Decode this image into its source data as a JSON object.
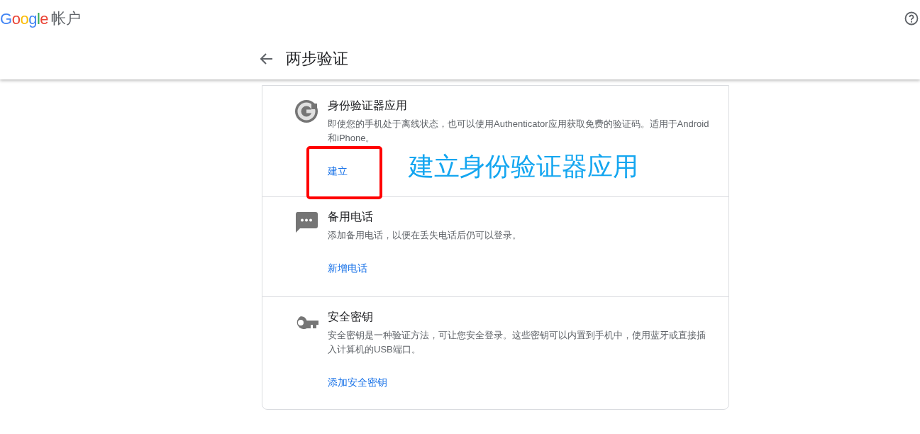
{
  "header": {
    "logo": "Google",
    "product": "帐户",
    "page_title": "两步验证"
  },
  "methods": [
    {
      "kind": "authenticator",
      "title": "身份验证器应用",
      "description": "即使您的手机处于离线状态，也可以使用Authenticator应用获取免费的验证码。适用于Android和iPhone。",
      "action": "建立"
    },
    {
      "kind": "phone",
      "title": "备用电话",
      "description": "添加备用电话，以便在丢失电话后仍可以登录。",
      "action": "新增电话"
    },
    {
      "kind": "key",
      "title": "安全密钥",
      "description": "安全密钥是一种验证方法，可让您安全登录。这些密钥可以内置到手机中，使用蓝牙或直接插入计算机的USB端口。",
      "action": "添加安全密钥"
    }
  ],
  "annotation": {
    "text": "建立身份验证器应用"
  }
}
